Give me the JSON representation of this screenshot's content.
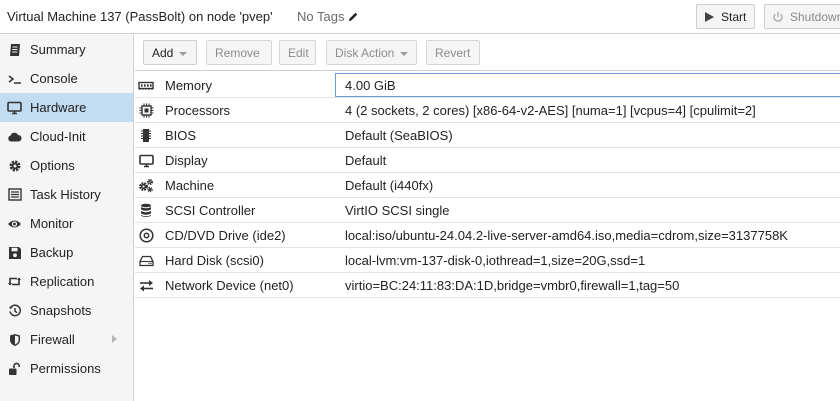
{
  "header": {
    "vm_title": "Virtual Machine 137 (PassBolt) on node 'pvep'",
    "tags_label": "No Tags",
    "start_label": "Start",
    "shutdown_label": "Shutdown"
  },
  "sidebar": {
    "items": [
      {
        "label": "Summary",
        "icon": "summary-icon"
      },
      {
        "label": "Console",
        "icon": "console-icon"
      },
      {
        "label": "Hardware",
        "icon": "hardware-icon"
      },
      {
        "label": "Cloud-Init",
        "icon": "cloud-icon"
      },
      {
        "label": "Options",
        "icon": "gear-icon"
      },
      {
        "label": "Task History",
        "icon": "list-icon"
      },
      {
        "label": "Monitor",
        "icon": "eye-icon"
      },
      {
        "label": "Backup",
        "icon": "floppy-icon"
      },
      {
        "label": "Replication",
        "icon": "retweet-icon"
      },
      {
        "label": "Snapshots",
        "icon": "history-icon"
      },
      {
        "label": "Firewall",
        "icon": "shield-icon"
      },
      {
        "label": "Permissions",
        "icon": "unlock-icon"
      }
    ],
    "active_index": 2
  },
  "toolbar": {
    "add_label": "Add",
    "remove_label": "Remove",
    "edit_label": "Edit",
    "disk_action_label": "Disk Action",
    "revert_label": "Revert"
  },
  "hardware": {
    "rows": [
      {
        "name": "Memory",
        "value": "4.00 GiB",
        "icon": "memory-icon"
      },
      {
        "name": "Processors",
        "value": "4 (2 sockets, 2 cores) [x86-64-v2-AES] [numa=1] [vcpus=4] [cpulimit=2]",
        "icon": "cpu-icon"
      },
      {
        "name": "BIOS",
        "value": "Default (SeaBIOS)",
        "icon": "microchip-icon"
      },
      {
        "name": "Display",
        "value": "Default",
        "icon": "desktop-icon"
      },
      {
        "name": "Machine",
        "value": "Default (i440fx)",
        "icon": "cogs-icon"
      },
      {
        "name": "SCSI Controller",
        "value": "VirtIO SCSI single",
        "icon": "database-icon"
      },
      {
        "name": "CD/DVD Drive (ide2)",
        "value": "local:iso/ubuntu-24.04.2-live-server-amd64.iso,media=cdrom,size=3137758K",
        "icon": "cdrom-icon"
      },
      {
        "name": "Hard Disk (scsi0)",
        "value": "local-lvm:vm-137-disk-0,iothread=1,size=20G,ssd=1",
        "icon": "hdd-icon"
      },
      {
        "name": "Network Device (net0)",
        "value": "virtio=BC:24:11:83:DA:1D,bridge=vmbr0,firewall=1,tag=50",
        "icon": "exchange-icon"
      }
    ]
  }
}
